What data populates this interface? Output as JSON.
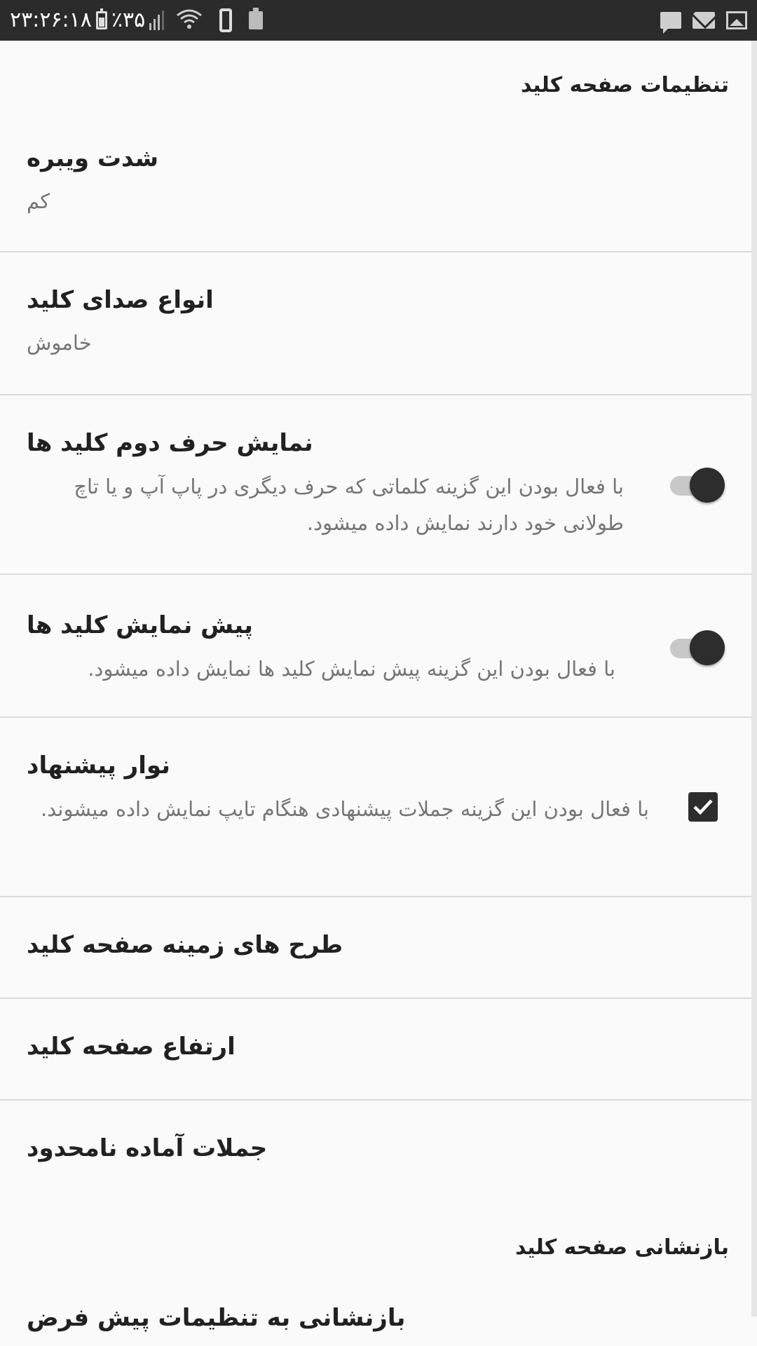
{
  "status_bar": {
    "time": "۲۳:۲۶:۱۸",
    "battery_percent": "٪۳۵",
    "icons_left": [
      "battery-icon",
      "signal-icon",
      "wifi-icon",
      "phone-icon",
      "battery-saver-icon"
    ],
    "icons_right": [
      "message-icon",
      "mail-icon",
      "image-icon"
    ]
  },
  "sections": {
    "keyboard_settings": {
      "header": "تنظیمات صفحه کلید"
    },
    "reset": {
      "header": "بازنشانی صفحه کلید"
    }
  },
  "prefs": {
    "vibration": {
      "title": "شدت ویبره",
      "value": "کم"
    },
    "key_sound": {
      "title": "انواع صدای کلید",
      "value": "خاموش"
    },
    "second_char": {
      "title": "نمایش حرف دوم کلید ها",
      "summary": "با فعال بودن این گزینه کلماتی که حرف دیگری در پاپ آپ و یا تاچ طولانی خود دارند نمایش داده میشود.",
      "enabled": true
    },
    "key_preview": {
      "title": "پیش نمایش کلید ها",
      "summary": "با فعال بودن این گزینه پیش نمایش کلید ها نمایش داده میشود.",
      "enabled": true
    },
    "suggestion_bar": {
      "title": "نوار پیشنهاد",
      "summary": "با فعال بودن این گزینه جملات پیشنهادی هنگام تایپ نمایش داده میشوند.",
      "checked": true
    },
    "themes": {
      "title": "طرح های زمینه صفحه کلید"
    },
    "height": {
      "title": "ارتفاع صفحه کلید"
    },
    "phrases": {
      "title": "جملات آماده نامحدود"
    },
    "reset_defaults": {
      "title": "بازنشانی به تنظیمات پیش فرض"
    }
  },
  "colors": {
    "status_bar": "#2b2b2b",
    "background": "#fafafa",
    "accent_control": "#2d2d2d",
    "summary_text": "#757575",
    "divider": "#dcdcdc"
  }
}
